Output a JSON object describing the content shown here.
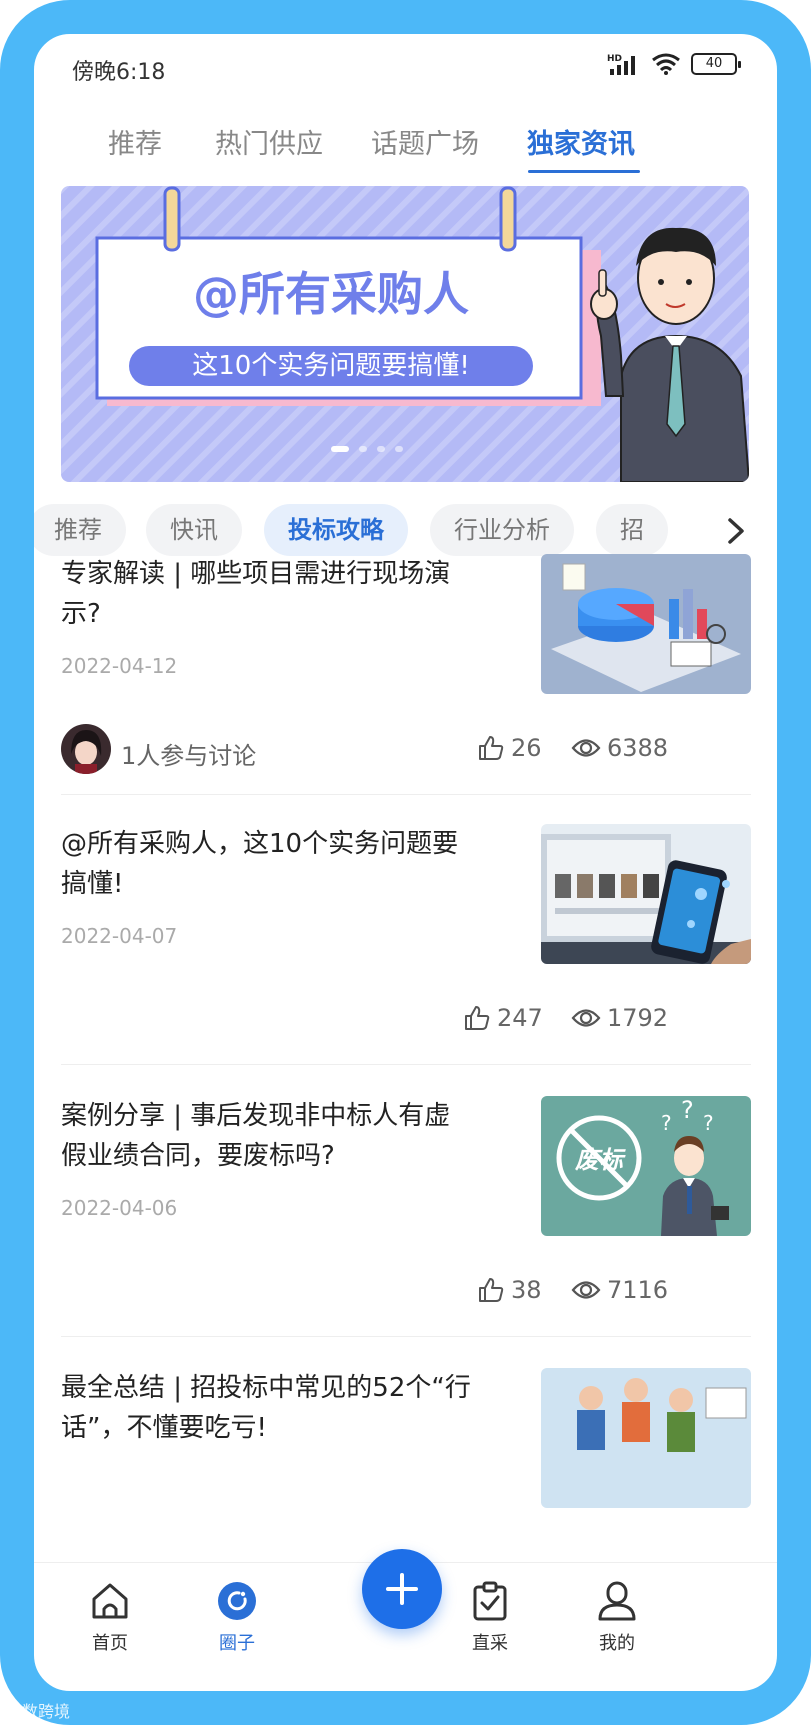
{
  "status_bar": {
    "time": "傍晚6:18",
    "network": "HD",
    "battery": "40"
  },
  "top_tabs": [
    {
      "label": "推荐",
      "active": false
    },
    {
      "label": "热门供应",
      "active": false
    },
    {
      "label": "话题广场",
      "active": false
    },
    {
      "label": "独家资讯",
      "active": true
    }
  ],
  "banner": {
    "title": "@所有采购人",
    "subtitle": "这10个实务问题要搞懂!",
    "slides": 4,
    "active_slide": 1
  },
  "chips": [
    {
      "label": "推荐",
      "active": false
    },
    {
      "label": "快讯",
      "active": false
    },
    {
      "label": "投标攻略",
      "active": true
    },
    {
      "label": "行业分析",
      "active": false
    },
    {
      "label": "招",
      "active": false
    }
  ],
  "articles": [
    {
      "title": "专家解读 | 哪些项目需进行现场演示?",
      "date": "2022-04-12",
      "discussion": "1人参与讨论",
      "likes": "26",
      "views": "6388"
    },
    {
      "title": "@所有采购人，这10个实务问题要搞懂!",
      "date": "2022-04-07",
      "discussion": "",
      "likes": "247",
      "views": "1792"
    },
    {
      "title": "案例分享 | 事后发现非中标人有虚假业绩合同，要废标吗?",
      "date": "2022-04-06",
      "discussion": "",
      "likes": "38",
      "views": "7116",
      "thumb_text": "废标"
    },
    {
      "title": "最全总结 | 招投标中常见的52个“行话”，不懂要吃亏!",
      "date": "",
      "discussion": "",
      "likes": "",
      "views": ""
    }
  ],
  "bottom_nav": [
    {
      "label": "首页",
      "icon": "home-icon",
      "active": false
    },
    {
      "label": "圈子",
      "icon": "circle-icon",
      "active": true
    },
    {
      "label": "直采",
      "icon": "clipboard-icon",
      "active": false
    },
    {
      "label": "我的",
      "icon": "profile-icon",
      "active": false
    }
  ],
  "watermark": "大数跨境",
  "colors": {
    "accent": "#2a6fd6",
    "frame": "#4cb8f8",
    "fab": "#1e6fe8",
    "banner_bg": "#b4baf6"
  }
}
